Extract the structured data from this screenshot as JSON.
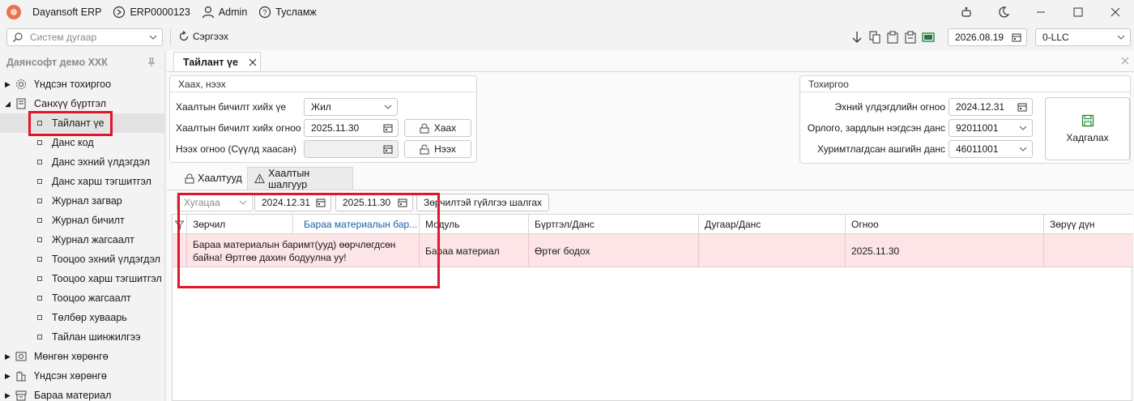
{
  "app": {
    "name": "Dayansoft ERP",
    "db_code": "ERP0000123",
    "user": "Admin",
    "help": "Тусламж"
  },
  "toolbar": {
    "search_placeholder": "Систем дугаар",
    "refresh_label": "Сэргээх",
    "work_date": "2026.08.19",
    "company": "0-LLC"
  },
  "sidebar": {
    "company_title": "Даянсофт демо ХХК",
    "items": [
      {
        "label": "Үндсэн тохиргоо",
        "icon": "gear-icon"
      },
      {
        "label": "Санхүү бүртгэл",
        "icon": "document-icon"
      }
    ],
    "sub_items": [
      "Тайлант үе",
      "Данс код",
      "Данс эхний үлдэгдэл",
      "Данс харш тэгшитгэл",
      "Журнал загвар",
      "Журнал бичилт",
      "Журнал жагсаалт",
      "Тооцоо эхний үлдэгдэл",
      "Тооцоо харш тэгшитгэл",
      "Тооцоо жагсаалт",
      "Төлбөр хуваарь",
      "Тайлан шинжилгээ"
    ],
    "bottom_items": [
      {
        "label": "Мөнгөн хөрөнгө",
        "icon": "cash-icon"
      },
      {
        "label": "Үндсэн хөрөнгө",
        "icon": "building-icon"
      },
      {
        "label": "Бараа материал",
        "icon": "box-icon"
      }
    ]
  },
  "document_tab": "Тайлант үе",
  "close_group": {
    "title": "Хаах, нээх",
    "period_label": "Хаалтын бичилт хийх үе",
    "period_value": "Жил",
    "date_label": "Хаалтын бичилт хийх огноо",
    "date_value": "2025.11.30",
    "close_button": "Хаах",
    "open_label": "Нээх огноо (Сүүлд хаасан)",
    "open_value": "",
    "open_button": "Нээх"
  },
  "settings_group": {
    "title": "Тохиргоо",
    "start_balance_label": "Эхний үлдэгдлийн огноо",
    "start_balance_value": "2024.12.31",
    "income_account_label": "Орлого, зардлын нэгдсэн данс",
    "income_account_value": "92011001",
    "retained_account_label": "Хуримтлагдсан ашгийн данс",
    "retained_account_value": "46011001",
    "save_button": "Хадгалах"
  },
  "sub_tabs": [
    "Хаалтууд",
    "Хаалтын шалгуур"
  ],
  "filter": {
    "period_placeholder": "Хугацаа",
    "date_from": "2024.12.31",
    "date_to": "2025.11.30",
    "check_button": "Зөрчилтэй гүйлгээ шалгах"
  },
  "grid": {
    "columns": [
      "Зөрчил",
      "Бараа материалын бар...",
      "Модуль",
      "Бүртгэл/Данс",
      "Дугаар/Данс",
      "Огноо",
      "Зөрүү дүн"
    ],
    "rows": [
      {
        "violation_line1": "Бараа материалын баримт(ууд) өөрчлөгдсөн",
        "violation_line2": "байна! Өртгөө дахин бодуулна уу!",
        "module": "Бараа материал",
        "register": "Өртөг бодох",
        "number": "",
        "date": "2025.11.30",
        "difference": ""
      }
    ]
  },
  "colors": {
    "highlight_box": "#e0162b",
    "error_row": "#fde4e6",
    "link_blue": "#1a5fa8",
    "save_green": "#2e8b3a"
  }
}
